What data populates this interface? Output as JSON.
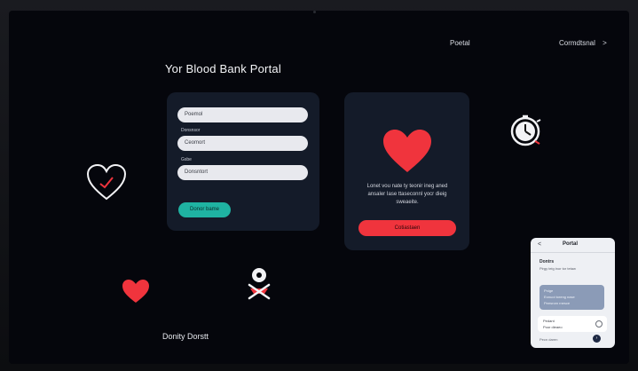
{
  "nav": {
    "left_link": "Poetal",
    "right_link": "Cormdtsnal",
    "right_arrow": ">"
  },
  "page": {
    "title": "Yor Blood Bank Portal"
  },
  "form": {
    "field1_placeholder": "Poemol",
    "label2": "Donsnsor",
    "field2_placeholder": "Ceomort",
    "label3": "Gsbe",
    "field3_placeholder": "Donsntort",
    "submit_label": "Donor bame"
  },
  "info_card": {
    "text": "Lonet vou nate ty teonir ineg aned ansaler Iase ttaseconnl yocr dieig sweaeite.",
    "button_label": "Cotiastaen"
  },
  "footer": {
    "text": "Donity Dorstt"
  },
  "phone": {
    "back": "<",
    "title": "Portal",
    "section": "Dontrs",
    "line": "Pirgy teig inor tor tetaw",
    "card_line1": "Pnige",
    "card_line2": "Eonuoi toreng nase",
    "card_line3": "Peesrom rnesce",
    "row_line1": "Pedant",
    "row_line2": "Poor dieaeo",
    "footer": "Pecn daren",
    "go": "›"
  },
  "colors": {
    "accent_red": "#f0343d",
    "accent_teal": "#1fb3a2",
    "card_bg": "#141b29"
  },
  "icons": [
    "heart-check-icon",
    "heart-icon",
    "clock-icon",
    "donor-icon"
  ]
}
